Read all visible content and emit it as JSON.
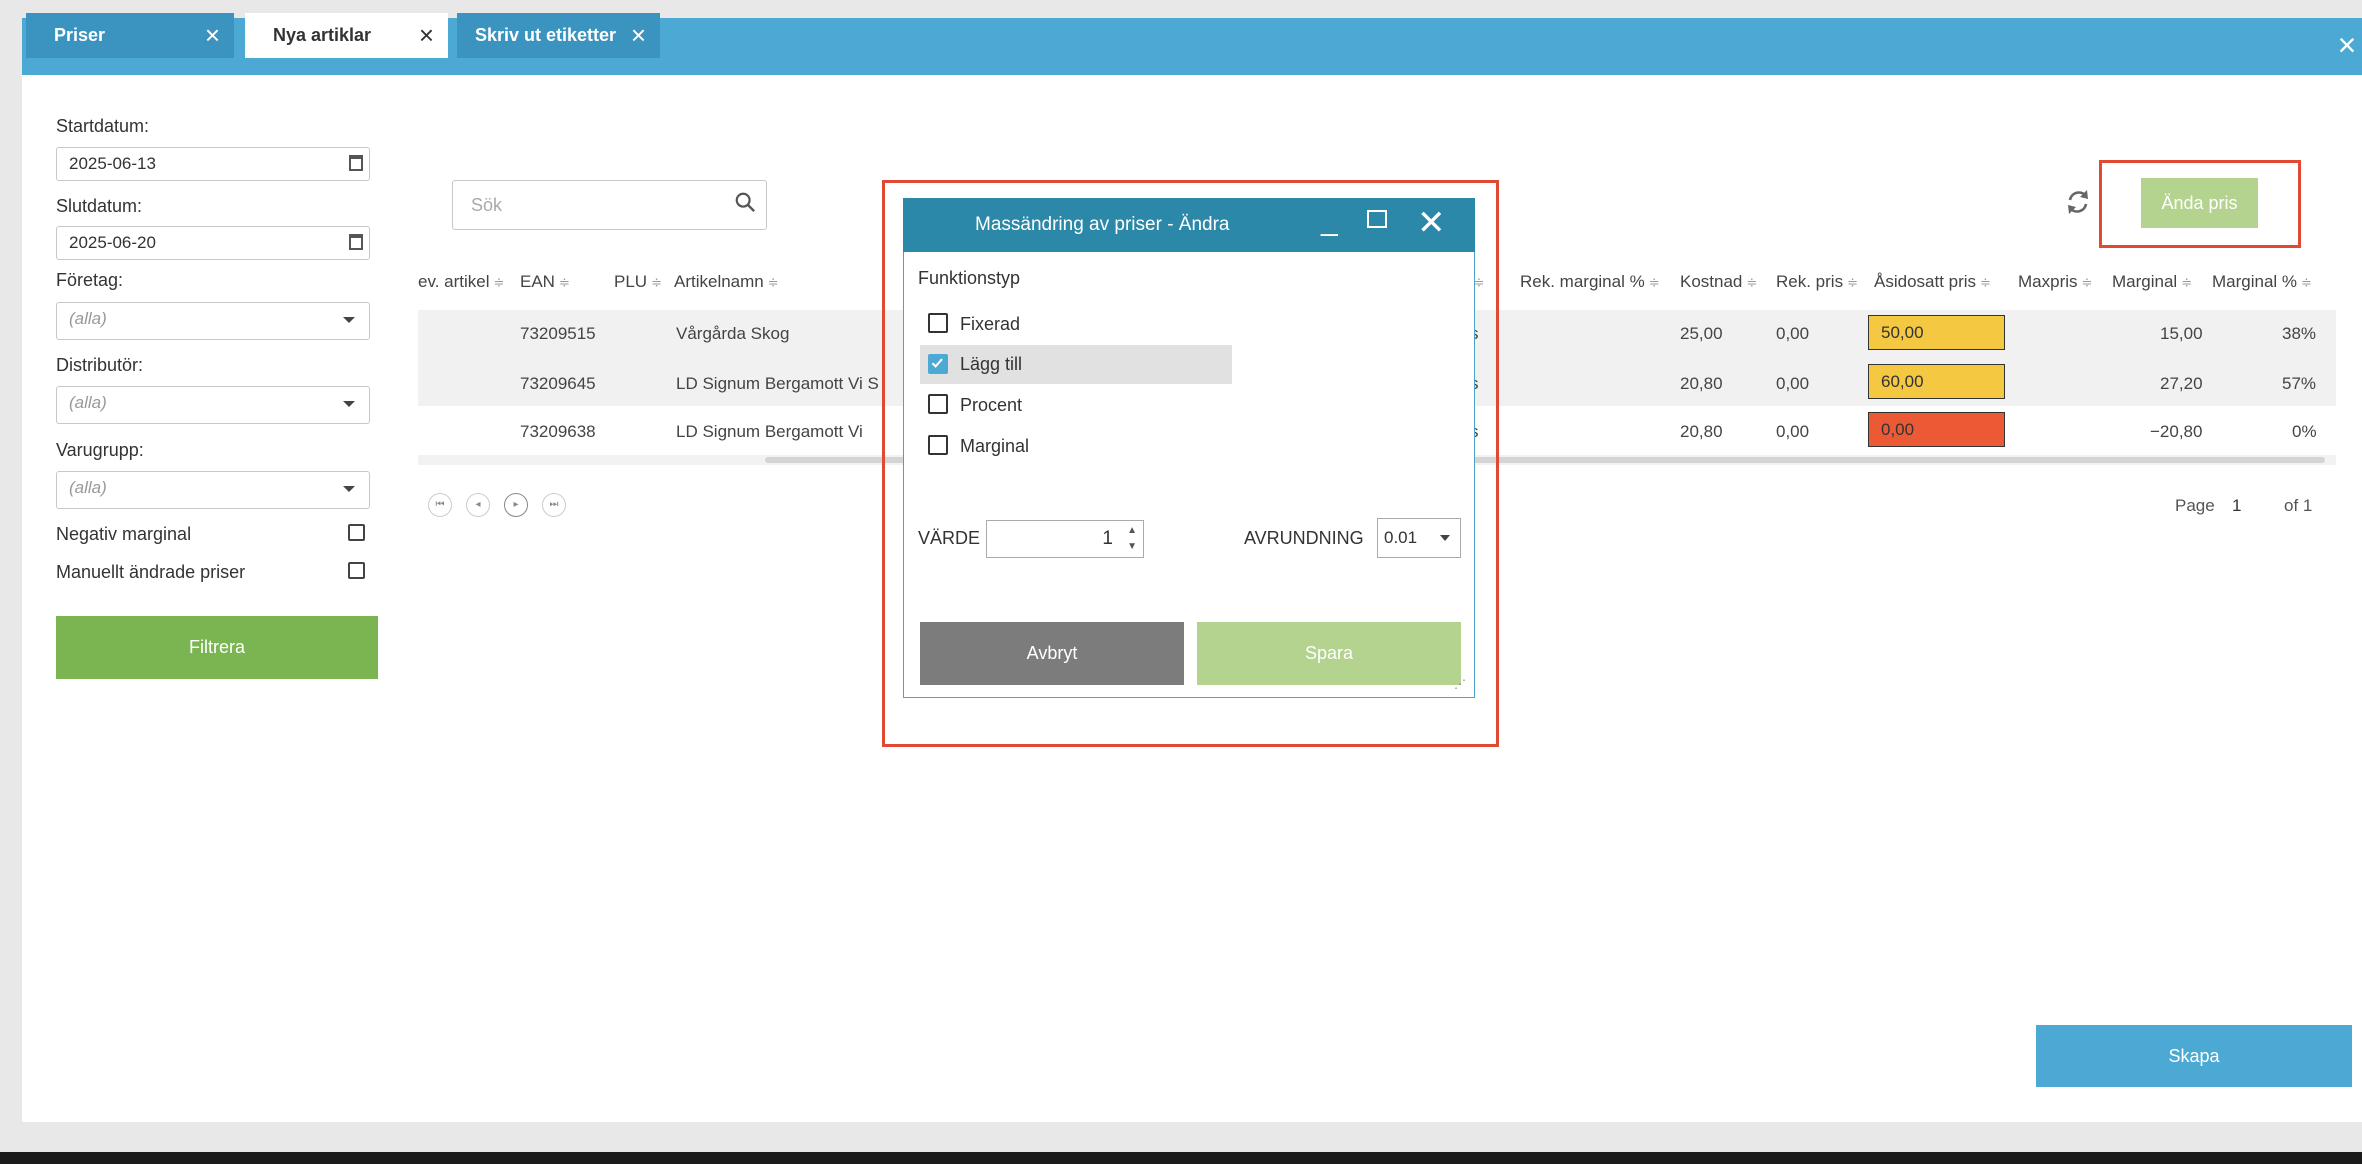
{
  "tabs": [
    {
      "label": "Priser"
    },
    {
      "label": "Nya artiklar"
    },
    {
      "label": "Skriv ut etiketter"
    }
  ],
  "filters": {
    "start_label": "Startdatum:",
    "start_value": "2025-06-13",
    "end_label": "Slutdatum:",
    "end_value": "2025-06-20",
    "company_label": "Företag:",
    "company_value": "(alla)",
    "distributor_label": "Distributör:",
    "distributor_value": "(alla)",
    "group_label": "Varugrupp:",
    "group_value": "(alla)",
    "negative_margin_label": "Negativ marginal",
    "manual_prices_label": "Manuellt ändrade priser",
    "filter_button": "Filtrera"
  },
  "search": {
    "placeholder": "Sök"
  },
  "toolbar": {
    "change_price": "Ända pris"
  },
  "table": {
    "headers": {
      "prev_article": "ev. artikel",
      "ean": "EAN",
      "plu": "PLU",
      "name": "Artikelnamn",
      "grp": "p",
      "rek_marginal": "Rek. marginal %",
      "cost": "Kostnad",
      "rek_price": "Rek. pris",
      "override": "Åsidosatt pris",
      "maxprice": "Maxpris",
      "margin": "Marginal",
      "margin_pct": "Marginal %"
    },
    "rows": [
      {
        "ean": "73209515",
        "name": "Vårgårda Skog",
        "grp": "s",
        "cost": "25,00",
        "rek_price": "0,00",
        "override": "50,00",
        "override_color": "#f5c842",
        "margin": "15,00",
        "margin_pct": "38%"
      },
      {
        "ean": "73209645",
        "name": "LD Signum Bergamott Vi S",
        "grp": "s",
        "cost": "20,80",
        "rek_price": "0,00",
        "override": "60,00",
        "override_color": "#f5c842",
        "margin": "27,20",
        "margin_pct": "57%"
      },
      {
        "ean": "73209638",
        "name": "LD Signum Bergamott Vi",
        "grp": "s",
        "cost": "20,80",
        "rek_price": "0,00",
        "override": "0,00",
        "override_color": "#ec5a35",
        "margin": "−20,80",
        "margin_pct": "0%"
      }
    ]
  },
  "pagination": {
    "page_label": "Page",
    "page": "1",
    "of_label": "of 1"
  },
  "dialog": {
    "title": "Massändring av priser - Ändra",
    "function_type_label": "Funktionstyp",
    "options": [
      {
        "label": "Fixerad",
        "checked": false
      },
      {
        "label": "Lägg till",
        "checked": true
      },
      {
        "label": "Procent",
        "checked": false
      },
      {
        "label": "Marginal",
        "checked": false
      }
    ],
    "value_label": "VÄRDE",
    "value": "1",
    "rounding_label": "AVRUNDNING",
    "rounding_value": "0.01",
    "cancel": "Avbryt",
    "save": "Spara"
  },
  "create_button": "Skapa",
  "colors": {
    "accent": "#4ba9d3",
    "green": "#7ab552",
    "highlight": "#e04a33"
  }
}
